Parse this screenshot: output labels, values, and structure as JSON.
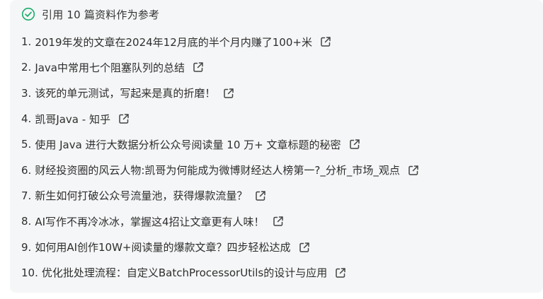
{
  "header": {
    "icon": "check-circle-icon",
    "text": "引用 10 篇资料作为参考",
    "icon_color": "#1aad6b"
  },
  "references": [
    {
      "num": "1.",
      "title": "2019年发的文章在2024年12月底的半个月内赚了100+米"
    },
    {
      "num": "2.",
      "title": "Java中常用七个阻塞队列的总结"
    },
    {
      "num": "3.",
      "title": "该死的单元测试，写起来是真的折磨！"
    },
    {
      "num": "4.",
      "title": "凯哥Java - 知乎"
    },
    {
      "num": "5.",
      "title": "使用 Java 进行大数据分析公众号阅读量 10 万+ 文章标题的秘密"
    },
    {
      "num": "6.",
      "title": "财经投资圈的风云人物:凯哥为何能成为微博财经达人榜第一?_分析_市场_观点"
    },
    {
      "num": "7.",
      "title": "新生如何打破公众号流量池，获得爆款流量？"
    },
    {
      "num": "8.",
      "title": "AI写作不再冷冰冰，掌握这4招让文章更有人味！"
    },
    {
      "num": "9.",
      "title": "如何用AI创作10W+阅读量的爆款文章？四步轻松达成"
    },
    {
      "num": "10.",
      "title": "优化批处理流程：自定义BatchProcessorUtils的设计与应用"
    }
  ],
  "link_icon": "external-link-icon",
  "colors": {
    "panel_bg": "#f5f6f7",
    "text": "#2e2e2e",
    "icon": "#444444"
  }
}
